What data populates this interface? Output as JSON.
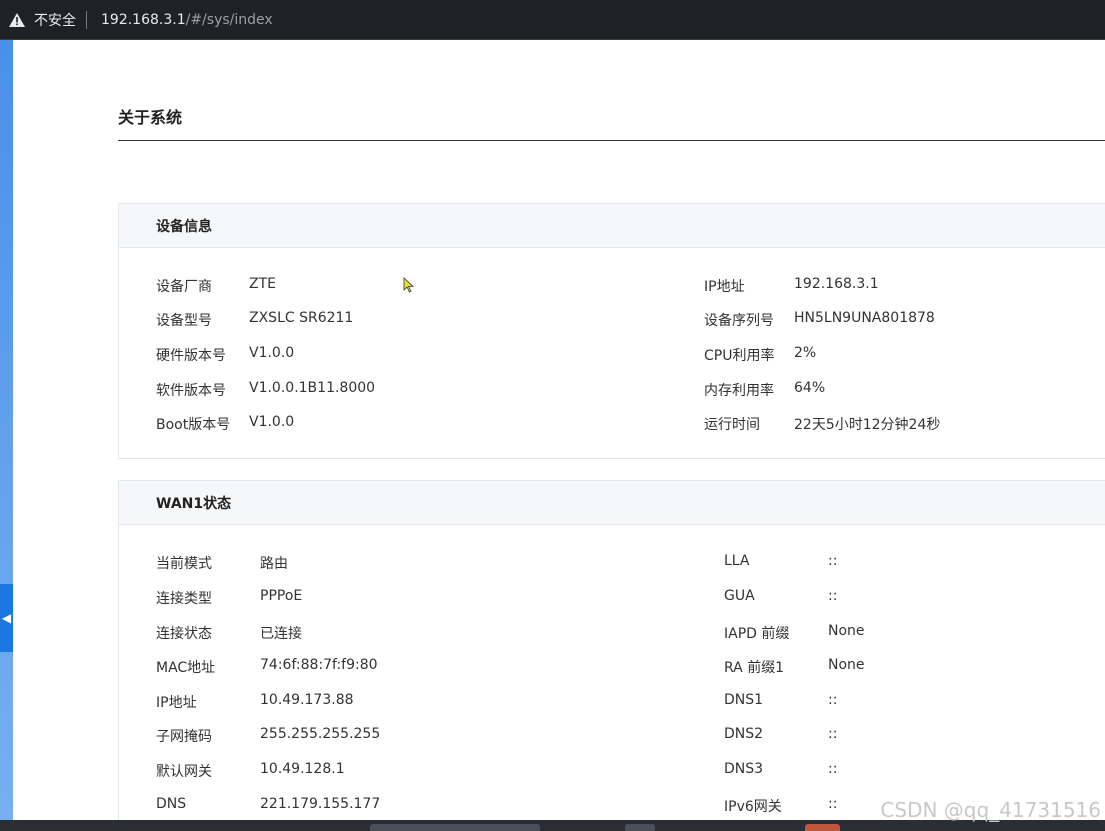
{
  "browser": {
    "security_label": "不安全",
    "url_host": "192.168.3.1",
    "url_path": "/#/sys/index"
  },
  "page": {
    "title": "关于系统"
  },
  "device_info": {
    "header": "设备信息",
    "left": [
      {
        "label": "设备厂商",
        "value": "ZTE"
      },
      {
        "label": "设备型号",
        "value": "ZXSLC SR6211"
      },
      {
        "label": "硬件版本号",
        "value": "V1.0.0"
      },
      {
        "label": "软件版本号",
        "value": "V1.0.0.1B11.8000"
      },
      {
        "label": "Boot版本号",
        "value": "V1.0.0"
      }
    ],
    "right": [
      {
        "label": "IP地址",
        "value": "192.168.3.1"
      },
      {
        "label": "设备序列号",
        "value": "HN5LN9UNA801878"
      },
      {
        "label": "CPU利用率",
        "value": "2%"
      },
      {
        "label": "内存利用率",
        "value": "64%"
      },
      {
        "label": "运行时间",
        "value": "22天5小时12分钟24秒"
      }
    ]
  },
  "wan1": {
    "header": "WAN1状态",
    "left": [
      {
        "label": "当前模式",
        "value": "路由"
      },
      {
        "label": "连接类型",
        "value": "PPPoE"
      },
      {
        "label": "连接状态",
        "value": "已连接"
      },
      {
        "label": "MAC地址",
        "value": "74:6f:88:7f:f9:80"
      },
      {
        "label": "IP地址",
        "value": "10.49.173.88"
      },
      {
        "label": "子网掩码",
        "value": "255.255.255.255"
      },
      {
        "label": "默认网关",
        "value": "10.49.128.1"
      },
      {
        "label": "DNS",
        "value": "221.179.155.177"
      }
    ],
    "right": [
      {
        "label": "LLA",
        "value": "::"
      },
      {
        "label": "GUA",
        "value": "::"
      },
      {
        "label": "IAPD 前缀",
        "value": "None"
      },
      {
        "label": "RA 前缀1",
        "value": "None"
      },
      {
        "label": "DNS1",
        "value": "::"
      },
      {
        "label": "DNS2",
        "value": "::"
      },
      {
        "label": "DNS3",
        "value": "::"
      },
      {
        "label": "IPv6网关",
        "value": "::"
      }
    ]
  },
  "watermark": "CSDN @qq_41731516",
  "colors": {
    "accent": "#1b78e0",
    "panel_header_bg": "#f6f7f9"
  }
}
